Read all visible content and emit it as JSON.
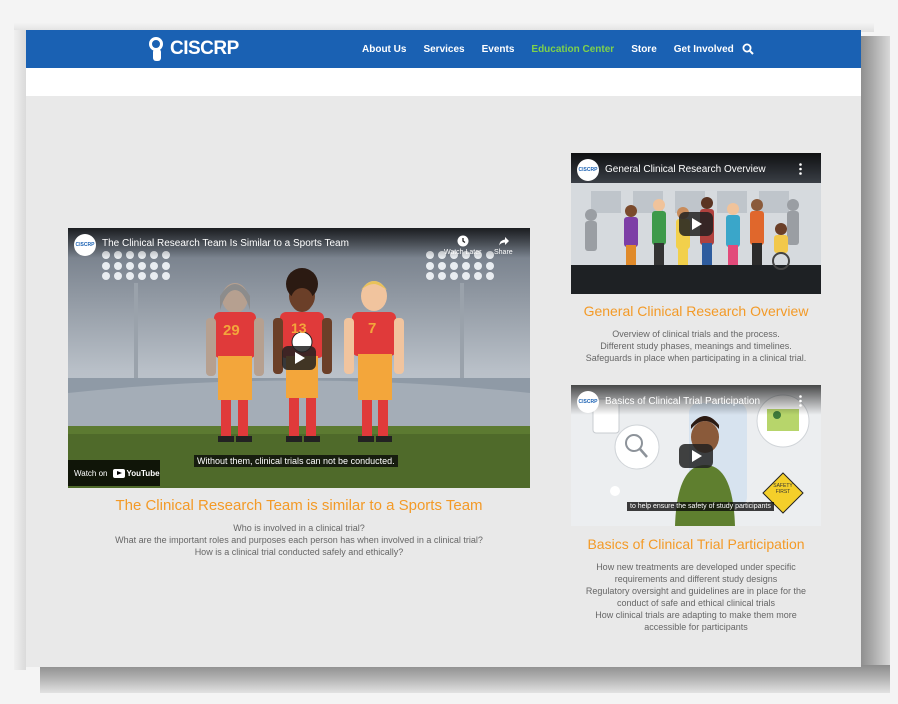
{
  "header": {
    "logo_text": "CISCRP",
    "nav": [
      "About Us",
      "Services",
      "Events",
      "Education Center",
      "Store",
      "Get Involved"
    ],
    "active_nav": "Education Center",
    "search_icon": "search-icon"
  },
  "videos": {
    "main": {
      "yt_title": "The Clinical Research Team Is Similar to a Sports Team",
      "watch_later": "Watch Later",
      "share": "Share",
      "caption": "Without them, clinical trials can not be conducted.",
      "watch_on": "Watch on",
      "youtube": "YouTube",
      "jerseys": [
        "29",
        "13",
        "7"
      ],
      "title": "The Clinical Research Team is similar to a Sports Team",
      "desc": [
        "Who is involved in a clinical trial?",
        "What are the important roles and purposes each person has when involved in a clinical trial?",
        "How is a clinical trial conducted safely and ethically?"
      ]
    },
    "overview": {
      "yt_title": "General Clinical Research Overview",
      "title": "General Clinical Research Overview",
      "desc": [
        "Overview of clinical trials and the process.",
        "Different study phases, meanings and timelines.",
        "Safeguards in place when participating in a clinical trial."
      ]
    },
    "basics": {
      "yt_title": "Basics of Clinical Trial Participation",
      "caption": "to help ensure the safety of study participants",
      "sign_text": "SAFETY FIRST",
      "title": "Basics of Clinical Trial Participation",
      "desc": [
        "How new treatments are developed under specific",
        "requirements and different study designs",
        "Regulatory oversight and guidelines are in place for the",
        "conduct of safe and ethical clinical trials",
        "How clinical trials are adapting to make them more",
        "accessible for participants"
      ]
    },
    "avatar_text": "CISCRP"
  },
  "colors": {
    "nav_bg": "#1a61b3",
    "active": "#7fd24a",
    "accent": "#f39a27"
  }
}
